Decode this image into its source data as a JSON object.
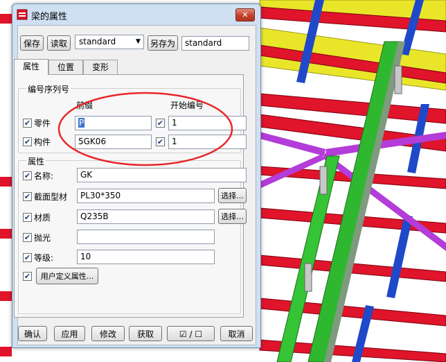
{
  "window": {
    "title": "梁的属性"
  },
  "toolbar": {
    "save_label": "保存",
    "load_label": "读取",
    "preset_value": "standard",
    "save_as_label": "另存为",
    "save_as_value": "standard"
  },
  "tabs": [
    {
      "label": "属性",
      "active": true
    },
    {
      "label": "位置",
      "active": false
    },
    {
      "label": "变形",
      "active": false
    }
  ],
  "numbering": {
    "group_label": "编号序列号",
    "prefix_header": "前缀",
    "start_header": "开始编号",
    "rows": [
      {
        "label": "零件",
        "checked": true,
        "prefix": "P",
        "start_checked": true,
        "start": "1"
      },
      {
        "label": "构件",
        "checked": true,
        "prefix": "5GK06",
        "start_checked": true,
        "start": "1"
      }
    ]
  },
  "attributes": {
    "group_label": "属性",
    "name_label": "名称:",
    "name_value": "GK",
    "profile_label": "截面型材",
    "profile_value": "PL30*350",
    "profile_select": "选择...",
    "material_label": "材质",
    "material_value": "Q235B",
    "material_select": "选择...",
    "finish_label": "抛光",
    "finish_value": "",
    "class_label": "等级:",
    "class_value": "10",
    "udf_label": "用户定义属性..."
  },
  "footer": {
    "ok_label": "确认",
    "apply_label": "应用",
    "modify_label": "修改",
    "get_label": "获取",
    "toggle_label": "☑ / ☐",
    "cancel_label": "取消"
  },
  "colors": {
    "dialog_frame": "#cfe0f2",
    "annotation_circle": "#e8262a",
    "beam_red": "#e0142a",
    "beam_yellow": "#e9e62a",
    "brace_blue": "#1f49c8",
    "brace_purple": "#b43cd8"
  }
}
